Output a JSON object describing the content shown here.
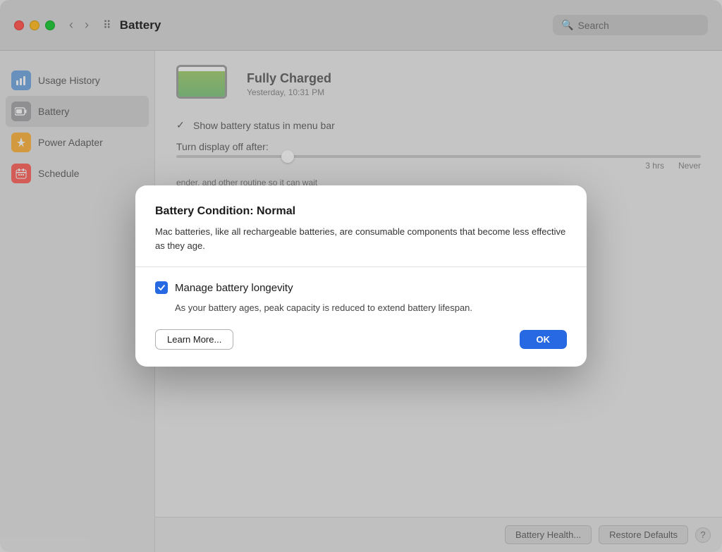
{
  "window": {
    "title": "Battery"
  },
  "titlebar": {
    "title": "Battery",
    "back_label": "‹",
    "forward_label": "›",
    "grid_label": "⠿",
    "search_placeholder": "Search"
  },
  "sidebar": {
    "items": [
      {
        "id": "usage-history",
        "label": "Usage History",
        "icon": "📊",
        "icon_type": "blue"
      },
      {
        "id": "battery",
        "label": "Battery",
        "icon": "🔋",
        "icon_type": "gray",
        "active": true
      },
      {
        "id": "power-adapter",
        "label": "Power Adapter",
        "icon": "⚡",
        "icon_type": "yellow"
      },
      {
        "id": "schedule",
        "label": "Schedule",
        "icon": "📅",
        "icon_type": "red"
      }
    ]
  },
  "main": {
    "battery_status": "Fully Charged",
    "battery_time": "Yesterday, 10:31 PM",
    "show_battery_label": "Show battery status in menu bar",
    "turn_display_label": "Turn display off after:",
    "slider_label1": "3 hrs",
    "slider_label2": "Never",
    "hint_text": "ender, and other\nroutine so it can wait"
  },
  "bottom_bar": {
    "battery_health_label": "Battery Health...",
    "restore_defaults_label": "Restore Defaults",
    "help_label": "?"
  },
  "modal": {
    "title": "Battery Condition: Normal",
    "description": "Mac batteries, like all rechargeable batteries, are consumable components that become less effective as they age.",
    "checkbox_label": "Manage battery longevity",
    "checkbox_checked": true,
    "checkbox_sublabel": "As your battery ages, peak capacity is reduced to extend battery lifespan.",
    "learn_more_label": "Learn More...",
    "ok_label": "OK"
  }
}
